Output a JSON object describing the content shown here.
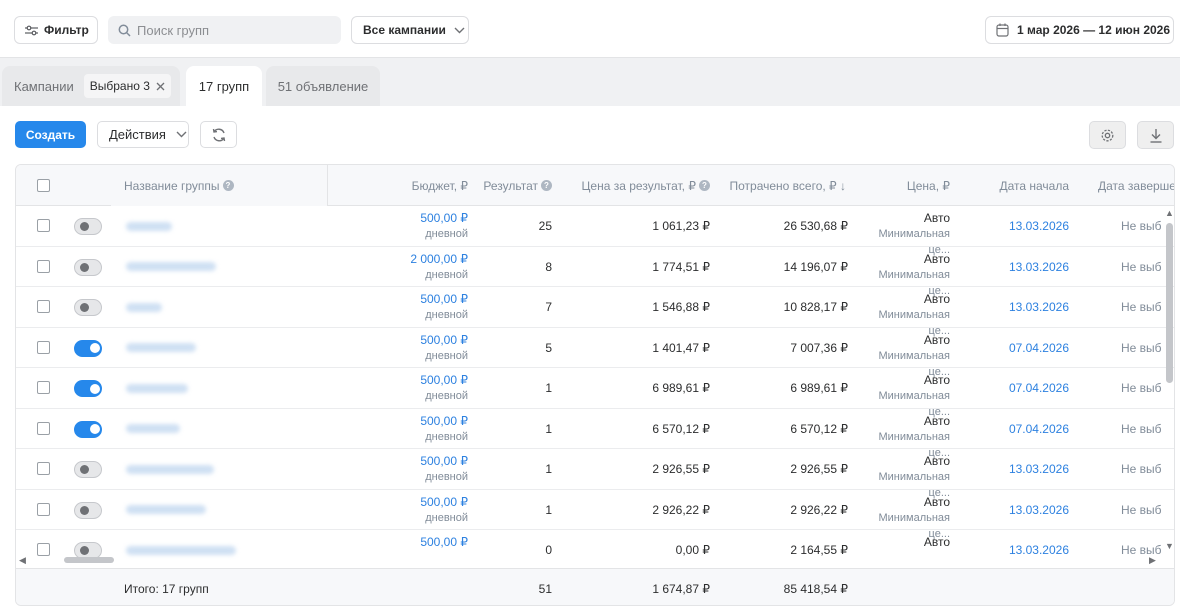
{
  "toolbar": {
    "filter_label": "Фильтр",
    "search_placeholder": "Поиск групп",
    "campaigns_select": "Все кампании",
    "date_range": "1 мар 2026 — 12 июн 2026"
  },
  "tabs": {
    "campaigns_label": "Кампании",
    "selected_chip": "Выбрано 3",
    "groups_label": "17 групп",
    "ads_label": "51 объявление"
  },
  "actions": {
    "create_label": "Создать",
    "actions_label": "Действия"
  },
  "columns": {
    "name": "Название группы",
    "budget": "Бюджет, ₽",
    "result": "Результат",
    "cost_per_result": "Цена за результат, ₽",
    "spent": "Потрачено всего, ₽ ↓",
    "price": "Цена, ₽",
    "start_date": "Дата начала",
    "end_date": "Дата завершен"
  },
  "rows": [
    {
      "enabled": false,
      "budget": "500,00 ₽",
      "budget_type": "дневной",
      "result": "25",
      "cpr": "1 061,23 ₽",
      "spent": "26 530,68 ₽",
      "price": "Авто",
      "price_sub": "Минимальная це...",
      "start": "13.03.2026",
      "end": "Не выб"
    },
    {
      "enabled": false,
      "budget": "2 000,00 ₽",
      "budget_type": "дневной",
      "result": "8",
      "cpr": "1 774,51 ₽",
      "spent": "14 196,07 ₽",
      "price": "Авто",
      "price_sub": "Минимальная це...",
      "start": "13.03.2026",
      "end": "Не выб"
    },
    {
      "enabled": false,
      "budget": "500,00 ₽",
      "budget_type": "дневной",
      "result": "7",
      "cpr": "1 546,88 ₽",
      "spent": "10 828,17 ₽",
      "price": "Авто",
      "price_sub": "Минимальная це...",
      "start": "13.03.2026",
      "end": "Не выб"
    },
    {
      "enabled": true,
      "budget": "500,00 ₽",
      "budget_type": "дневной",
      "result": "5",
      "cpr": "1 401,47 ₽",
      "spent": "7 007,36 ₽",
      "price": "Авто",
      "price_sub": "Минимальная це...",
      "start": "07.04.2026",
      "end": "Не выб"
    },
    {
      "enabled": true,
      "budget": "500,00 ₽",
      "budget_type": "дневной",
      "result": "1",
      "cpr": "6 989,61 ₽",
      "spent": "6 989,61 ₽",
      "price": "Авто",
      "price_sub": "Минимальная це...",
      "start": "07.04.2026",
      "end": "Не выб"
    },
    {
      "enabled": true,
      "budget": "500,00 ₽",
      "budget_type": "дневной",
      "result": "1",
      "cpr": "6 570,12 ₽",
      "spent": "6 570,12 ₽",
      "price": "Авто",
      "price_sub": "Минимальная це...",
      "start": "07.04.2026",
      "end": "Не выб"
    },
    {
      "enabled": false,
      "budget": "500,00 ₽",
      "budget_type": "дневной",
      "result": "1",
      "cpr": "2 926,55 ₽",
      "spent": "2 926,55 ₽",
      "price": "Авто",
      "price_sub": "Минимальная це...",
      "start": "13.03.2026",
      "end": "Не выб"
    },
    {
      "enabled": false,
      "budget": "500,00 ₽",
      "budget_type": "дневной",
      "result": "1",
      "cpr": "2 926,22 ₽",
      "spent": "2 926,22 ₽",
      "price": "Авто",
      "price_sub": "Минимальная це...",
      "start": "13.03.2026",
      "end": "Не выб"
    },
    {
      "enabled": false,
      "budget": "500,00 ₽",
      "budget_type": "",
      "result": "0",
      "cpr": "0,00 ₽",
      "spent": "2 164,55 ₽",
      "price": "Авто",
      "price_sub": "",
      "start": "13.03.2026",
      "end": "Не выб"
    }
  ],
  "footer": {
    "total_label": "Итого: 17 групп",
    "result": "51",
    "cpr": "1 674,87 ₽",
    "spent": "85 418,54 ₽"
  },
  "colors": {
    "accent": "#2688eb",
    "link": "#2d81e0"
  }
}
